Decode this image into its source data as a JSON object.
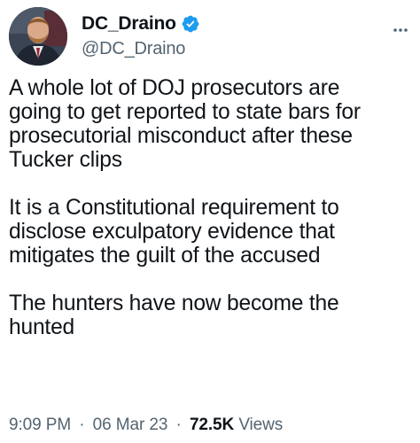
{
  "author": {
    "display_name": "DC_Draino",
    "handle": "@DC_Draino",
    "verified": true
  },
  "tweet": {
    "paragraphs": [
      {
        "lines": [
          "A whole lot of DOJ prosecutors are",
          "going to get reported to state bars for",
          "prosecutorial misconduct after these",
          "Tucker clips"
        ]
      },
      {
        "lines": [
          "It is a Constitutional requirement to",
          "disclose exculpatory evidence that",
          "mitigates the guilt of the accused"
        ]
      },
      {
        "lines": [
          "The hunters have now become the",
          "hunted"
        ]
      }
    ]
  },
  "meta": {
    "time": "9:09 PM",
    "separator": "·",
    "date": "06 Mar 23",
    "views_count": "72.5K",
    "views_label": "Views"
  },
  "colors": {
    "text": "#0f1419",
    "secondary": "#536471",
    "verified_badge": "#1d9bf0"
  },
  "icons": {
    "verified": "verified-badge-icon",
    "more": "more-options-icon"
  }
}
